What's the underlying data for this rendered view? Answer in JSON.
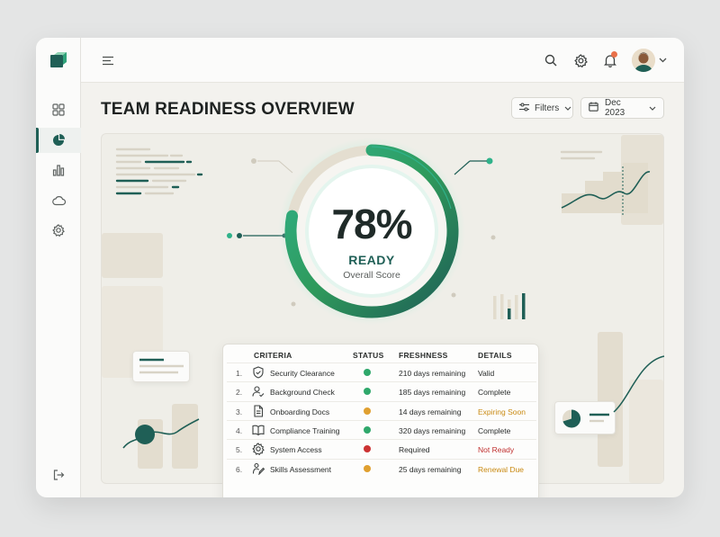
{
  "page": {
    "title": "TEAM READINESS OVERVIEW"
  },
  "toolbar": {
    "filters_label": "Filters",
    "date_label": "Dec 2023"
  },
  "score": {
    "value": "78%",
    "status": "READY",
    "caption": "Overall Score",
    "fraction": 0.78
  },
  "table": {
    "headers": {
      "criteria": "CRITERIA",
      "status": "STATUS",
      "freshness": "FRESHNESS",
      "details": "DETAILS"
    },
    "rows": [
      {
        "num": "1.",
        "icon": "shield-icon",
        "name": "Security Clearance",
        "status_color": "#2fa86b",
        "freshness": "210 days remaining",
        "detail": "Valid",
        "detail_color": "#2a2d2c"
      },
      {
        "num": "2.",
        "icon": "user-check-icon",
        "name": "Background Check",
        "status_color": "#2fa86b",
        "freshness": "185 days remaining",
        "detail": "Complete",
        "detail_color": "#2a2d2c"
      },
      {
        "num": "3.",
        "icon": "document-icon",
        "name": "Onboarding Docs",
        "status_color": "#e0a030",
        "freshness": "14 days remaining",
        "detail": "Expiring Soon",
        "detail_color": "#c98a12"
      },
      {
        "num": "4.",
        "icon": "book-icon",
        "name": "Compliance Training",
        "status_color": "#2fa86b",
        "freshness": "320 days remaining",
        "detail": "Complete",
        "detail_color": "#2a2d2c"
      },
      {
        "num": "5.",
        "icon": "gear-icon",
        "name": "System Access",
        "status_color": "#cc3333",
        "freshness": "Required",
        "detail": "Not Ready",
        "detail_color": "#c0302f"
      },
      {
        "num": "6.",
        "icon": "skills-icon",
        "name": "Skills Assessment",
        "status_color": "#e0a030",
        "freshness": "25 days remaining",
        "detail": "Renewal Due",
        "detail_color": "#c98a12"
      }
    ]
  },
  "colors": {
    "brand": "#1f5f56",
    "accent": "#2fb28a",
    "warning": "#e0a030",
    "danger": "#cc3333"
  }
}
